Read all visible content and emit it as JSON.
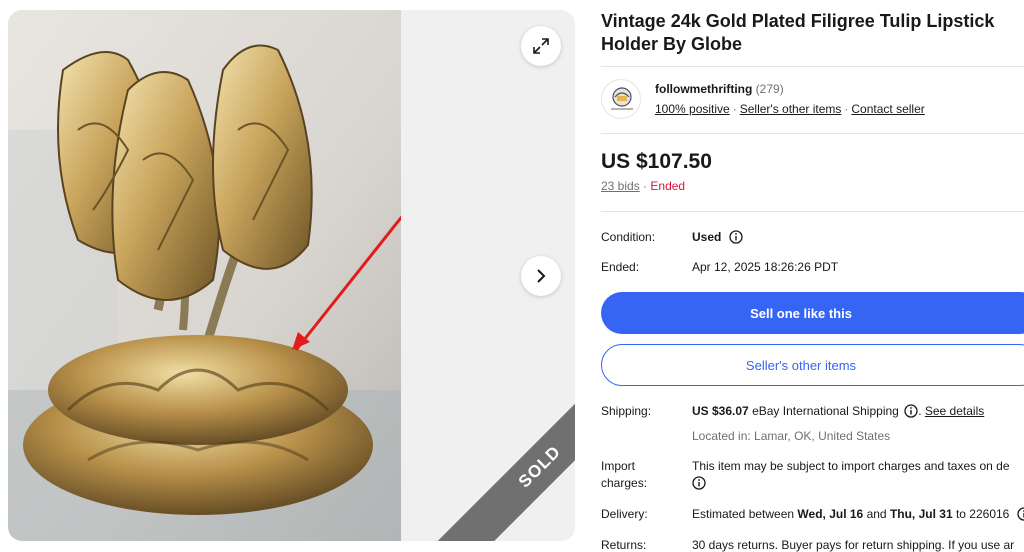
{
  "listing": {
    "title": "Vintage 24k Gold Plated Filigree Tulip Lipstick Holder By Globe",
    "sold_badge": "SOLD"
  },
  "seller": {
    "name": "followmethrifting",
    "feedback_count": "(279)",
    "positive": "100% positive",
    "other_items": "Seller's other items",
    "contact": "Contact seller"
  },
  "price": {
    "amount": "US $107.50",
    "bids": "23 bids",
    "separator": "·",
    "status": "Ended"
  },
  "details": {
    "condition_label": "Condition:",
    "condition_value": "Used",
    "ended_label": "Ended:",
    "ended_value": "Apr 12, 2025 18:26:26 PDT"
  },
  "actions": {
    "sell_one": "Sell one like this",
    "seller_items": "Seller's other items"
  },
  "shipping": {
    "label": "Shipping:",
    "amount": "US $36.07",
    "method": "eBay International Shipping",
    "see_details": "See details",
    "location": "Located in: Lamar, OK, United States"
  },
  "import": {
    "label_line1": "Import",
    "label_line2": "charges:",
    "text": "This item may be subject to import charges and taxes on de"
  },
  "delivery": {
    "label": "Delivery:",
    "prefix": "Estimated between",
    "start": "Wed, Jul 16",
    "and": "and",
    "end": "Thu, Jul 31",
    "suffix": "to 226016"
  },
  "returns": {
    "label": "Returns:",
    "text": "30 days returns. Buyer pays for return shipping. If you use ar"
  },
  "colors": {
    "primary": "#3665f3",
    "ended": "#e0103a",
    "sold_ribbon": "#707070"
  }
}
